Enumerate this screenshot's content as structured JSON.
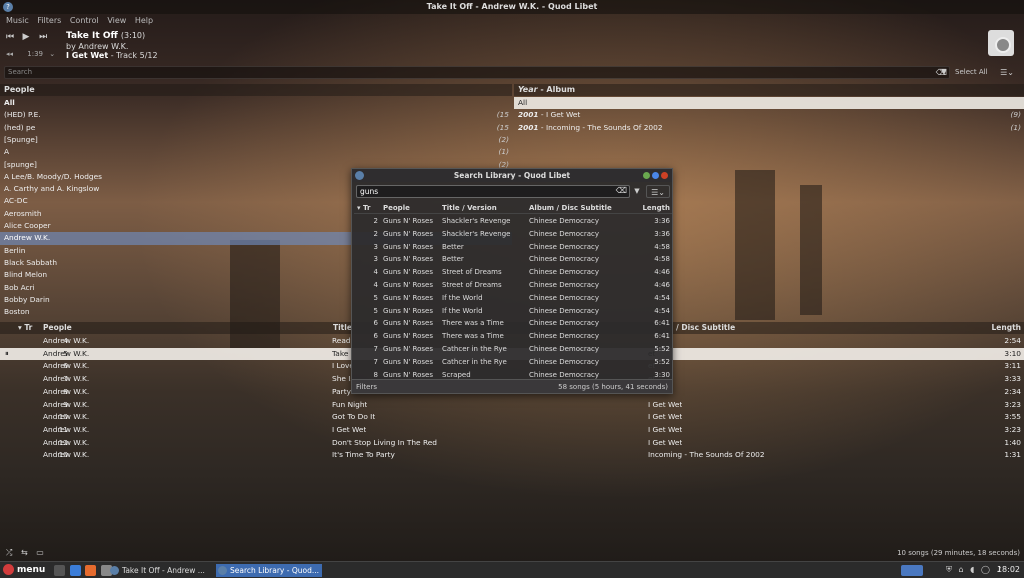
{
  "window": {
    "title": "Take It Off - Andrew W.K. - Quod Libet"
  },
  "menu": [
    "Music",
    "Filters",
    "Control",
    "View",
    "Help"
  ],
  "player": {
    "time": "1:39",
    "title": "Take It Off",
    "duration": "(3:10)",
    "by": "by Andrew W.K.",
    "album": "I Get Wet",
    "track_info": " - Track 5/12"
  },
  "search": {
    "placeholder": "Search",
    "select_all": "Select All"
  },
  "people_pane": {
    "header": "People",
    "items": [
      {
        "name": "All",
        "count": ""
      },
      {
        "name": "(HED) P.E.",
        "count": "(15"
      },
      {
        "name": "(hed) pe",
        "count": "(15"
      },
      {
        "name": "[Spunge]",
        "count": "(2)"
      },
      {
        "name": "A",
        "count": "(1)"
      },
      {
        "name": "[spunge]",
        "count": "(2)"
      },
      {
        "name": "A Lee/B. Moody/D. Hodges",
        "count": ""
      },
      {
        "name": "A. Carthy and A. Kingslow",
        "count": ""
      },
      {
        "name": "AC-DC",
        "count": ""
      },
      {
        "name": "Aerosmith",
        "count": ""
      },
      {
        "name": "Alice Cooper",
        "count": ""
      },
      {
        "name": "Andrew W.K.",
        "count": ""
      },
      {
        "name": "Berlin",
        "count": ""
      },
      {
        "name": "Black Sabbath",
        "count": ""
      },
      {
        "name": "Blind Melon",
        "count": ""
      },
      {
        "name": "Bob Acri",
        "count": ""
      },
      {
        "name": "Bobby Darin",
        "count": ""
      },
      {
        "name": "Boston",
        "count": ""
      }
    ]
  },
  "album_pane": {
    "header_year": "Year",
    "header_sep": " - ",
    "header_album": "Album",
    "items": [
      {
        "year": "",
        "album": "All",
        "count": ""
      },
      {
        "year": "2001",
        "album": " - I Get Wet",
        "count": "(9)"
      },
      {
        "year": "2001",
        "album": " - Incoming - The Sounds Of 2002",
        "count": "(1)"
      }
    ]
  },
  "songs": {
    "headers": {
      "track": "Tr",
      "people": "People",
      "title": "Title",
      "album": "/ Disc Subtitle",
      "length": "Length"
    },
    "rows": [
      {
        "num": "4",
        "people": "Andrew W.K.",
        "title": "Ready",
        "album": "",
        "length": "2:54"
      },
      {
        "num": "5",
        "people": "Andrew W.K.",
        "title": "Take I",
        "album": "et",
        "length": "3:10"
      },
      {
        "num": "6",
        "people": "Andrew W.K.",
        "title": "I Love",
        "album": "et",
        "length": "3:11"
      },
      {
        "num": "7",
        "people": "Andrew W.K.",
        "title": "She Is",
        "album": "et",
        "length": "3:33"
      },
      {
        "num": "8",
        "people": "Andrew W.K.",
        "title": "Party",
        "album": "et",
        "length": "2:34"
      },
      {
        "num": "9",
        "people": "Andrew W.K.",
        "title": "Fun Night",
        "album": "I Get Wet",
        "length": "3:23"
      },
      {
        "num": "10",
        "people": "Andrew W.K.",
        "title": "Got To Do It",
        "album": "I Get Wet",
        "length": "3:55"
      },
      {
        "num": "11",
        "people": "Andrew W.K.",
        "title": "I Get Wet",
        "album": "I Get Wet",
        "length": "3:23"
      },
      {
        "num": "12",
        "people": "Andrew W.K.",
        "title": "Don't Stop Living In The Red",
        "album": "I Get Wet",
        "length": "1:40"
      },
      {
        "num": "10",
        "people": "Andrew W.K.",
        "title": "It's Time To Party",
        "album": "Incoming - The Sounds Of 2002",
        "length": "1:31"
      }
    ],
    "status": "10 songs (29 minutes, 18 seconds)"
  },
  "dialog": {
    "title": "Search Library - Quod Libet",
    "query": "guns",
    "headers": {
      "track": "Tr",
      "people": "People",
      "title": "Title / Version",
      "album": "Album / Disc Subtitle",
      "length": "Length"
    },
    "rows": [
      {
        "num": "2",
        "people": "Guns N' Roses",
        "title": "Shackler's Revenge",
        "album": "Chinese Democracy",
        "length": "3:36"
      },
      {
        "num": "2",
        "people": "Guns N' Roses",
        "title": "Shackler's Revenge",
        "album": "Chinese Democracy",
        "length": "3:36"
      },
      {
        "num": "3",
        "people": "Guns N' Roses",
        "title": "Better",
        "album": "Chinese Democracy",
        "length": "4:58"
      },
      {
        "num": "3",
        "people": "Guns N' Roses",
        "title": "Better",
        "album": "Chinese Democracy",
        "length": "4:58"
      },
      {
        "num": "4",
        "people": "Guns N' Roses",
        "title": "Street of Dreams",
        "album": "Chinese Democracy",
        "length": "4:46"
      },
      {
        "num": "4",
        "people": "Guns N' Roses",
        "title": "Street of Dreams",
        "album": "Chinese Democracy",
        "length": "4:46"
      },
      {
        "num": "5",
        "people": "Guns N' Roses",
        "title": "If the World",
        "album": "Chinese Democracy",
        "length": "4:54"
      },
      {
        "num": "5",
        "people": "Guns N' Roses",
        "title": "If the World",
        "album": "Chinese Democracy",
        "length": "4:54"
      },
      {
        "num": "6",
        "people": "Guns N' Roses",
        "title": "There was a Time",
        "album": "Chinese Democracy",
        "length": "6:41"
      },
      {
        "num": "6",
        "people": "Guns N' Roses",
        "title": "There was a Time",
        "album": "Chinese Democracy",
        "length": "6:41"
      },
      {
        "num": "7",
        "people": "Guns N' Roses",
        "title": "Cathcer in the Rye",
        "album": "Chinese Democracy",
        "length": "5:52"
      },
      {
        "num": "7",
        "people": "Guns N' Roses",
        "title": "Cathcer in the Rye",
        "album": "Chinese Democracy",
        "length": "5:52"
      },
      {
        "num": "8",
        "people": "Guns N' Roses",
        "title": "Scraped",
        "album": "Chinese Democracy",
        "length": "3:30"
      }
    ],
    "filters_label": "Filters",
    "status": "58 songs (5 hours, 41 seconds)"
  },
  "taskbar": {
    "menu_label": "menu",
    "tasks": [
      "Take It Off - Andrew ...",
      "Search Library - Quod..."
    ],
    "clock": "18:02"
  },
  "icons": {
    "transport": [
      "previous-icon",
      "play-icon",
      "next-icon"
    ],
    "app": "quodlibet-icon"
  }
}
